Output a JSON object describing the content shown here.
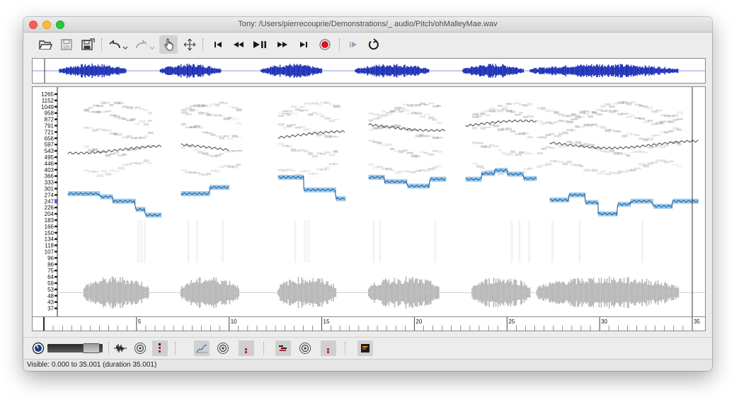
{
  "window": {
    "title": "Tony: /Users/pierrecouprie/Demonstrations/_ audio/Pitch/ohMalleyMae.wav"
  },
  "toolbar": {
    "buttons": [
      {
        "name": "open-icon"
      },
      {
        "name": "save-icon"
      },
      {
        "name": "save-as-icon"
      },
      {
        "name": "undo-icon"
      },
      {
        "name": "redo-icon"
      },
      {
        "name": "navigate-hand-icon",
        "pressed": true
      },
      {
        "name": "move-icon"
      },
      {
        "name": "rewind-start-icon"
      },
      {
        "name": "rewind-icon"
      },
      {
        "name": "play-pause-icon"
      },
      {
        "name": "fast-forward-icon"
      },
      {
        "name": "fast-forward-end-icon"
      },
      {
        "name": "record-icon"
      },
      {
        "name": "play-selection-icon"
      },
      {
        "name": "loop-icon"
      }
    ]
  },
  "pitch_axis": {
    "labels": [
      "1265",
      "1152",
      "1049",
      "958",
      "872",
      "791",
      "721",
      "656",
      "597",
      "543",
      "495",
      "446",
      "403",
      "366",
      "333",
      "301",
      "274",
      "247",
      "226",
      "204",
      "183",
      "166",
      "150",
      "134",
      "118",
      "107",
      "96",
      "86",
      "75",
      "64",
      "59",
      "53",
      "48",
      "43",
      "37"
    ]
  },
  "time_ruler": {
    "labels": [
      "5",
      "10",
      "15",
      "20",
      "25",
      "30",
      "35"
    ],
    "start": 0,
    "end": 35.001
  },
  "layer_controls": {
    "items": [
      {
        "name": "volume-dial-icon"
      },
      {
        "name": "gain-slider"
      },
      {
        "name": "waveform-layer-icon"
      },
      {
        "name": "waveform-play-icon"
      },
      {
        "name": "waveform-level-meter"
      },
      {
        "name": "pitch-layer-icon",
        "pressed": true
      },
      {
        "name": "pitch-play-icon"
      },
      {
        "name": "pitch-level-meter"
      },
      {
        "name": "notes-layer-icon",
        "pressed": true
      },
      {
        "name": "notes-play-icon"
      },
      {
        "name": "notes-level-meter"
      },
      {
        "name": "spectrogram-layer-icon",
        "pressed": true
      }
    ]
  },
  "status": {
    "text": "Visible: 0.000 to 35.001 (duration 35.001)"
  },
  "colors": {
    "waveform_overview": "#1d2fb5",
    "pitch_note": "#8fc3e8",
    "pitch_line": "#1f5ea3",
    "waveform_main": "#b8b8b8",
    "record": "#e0101c"
  }
}
